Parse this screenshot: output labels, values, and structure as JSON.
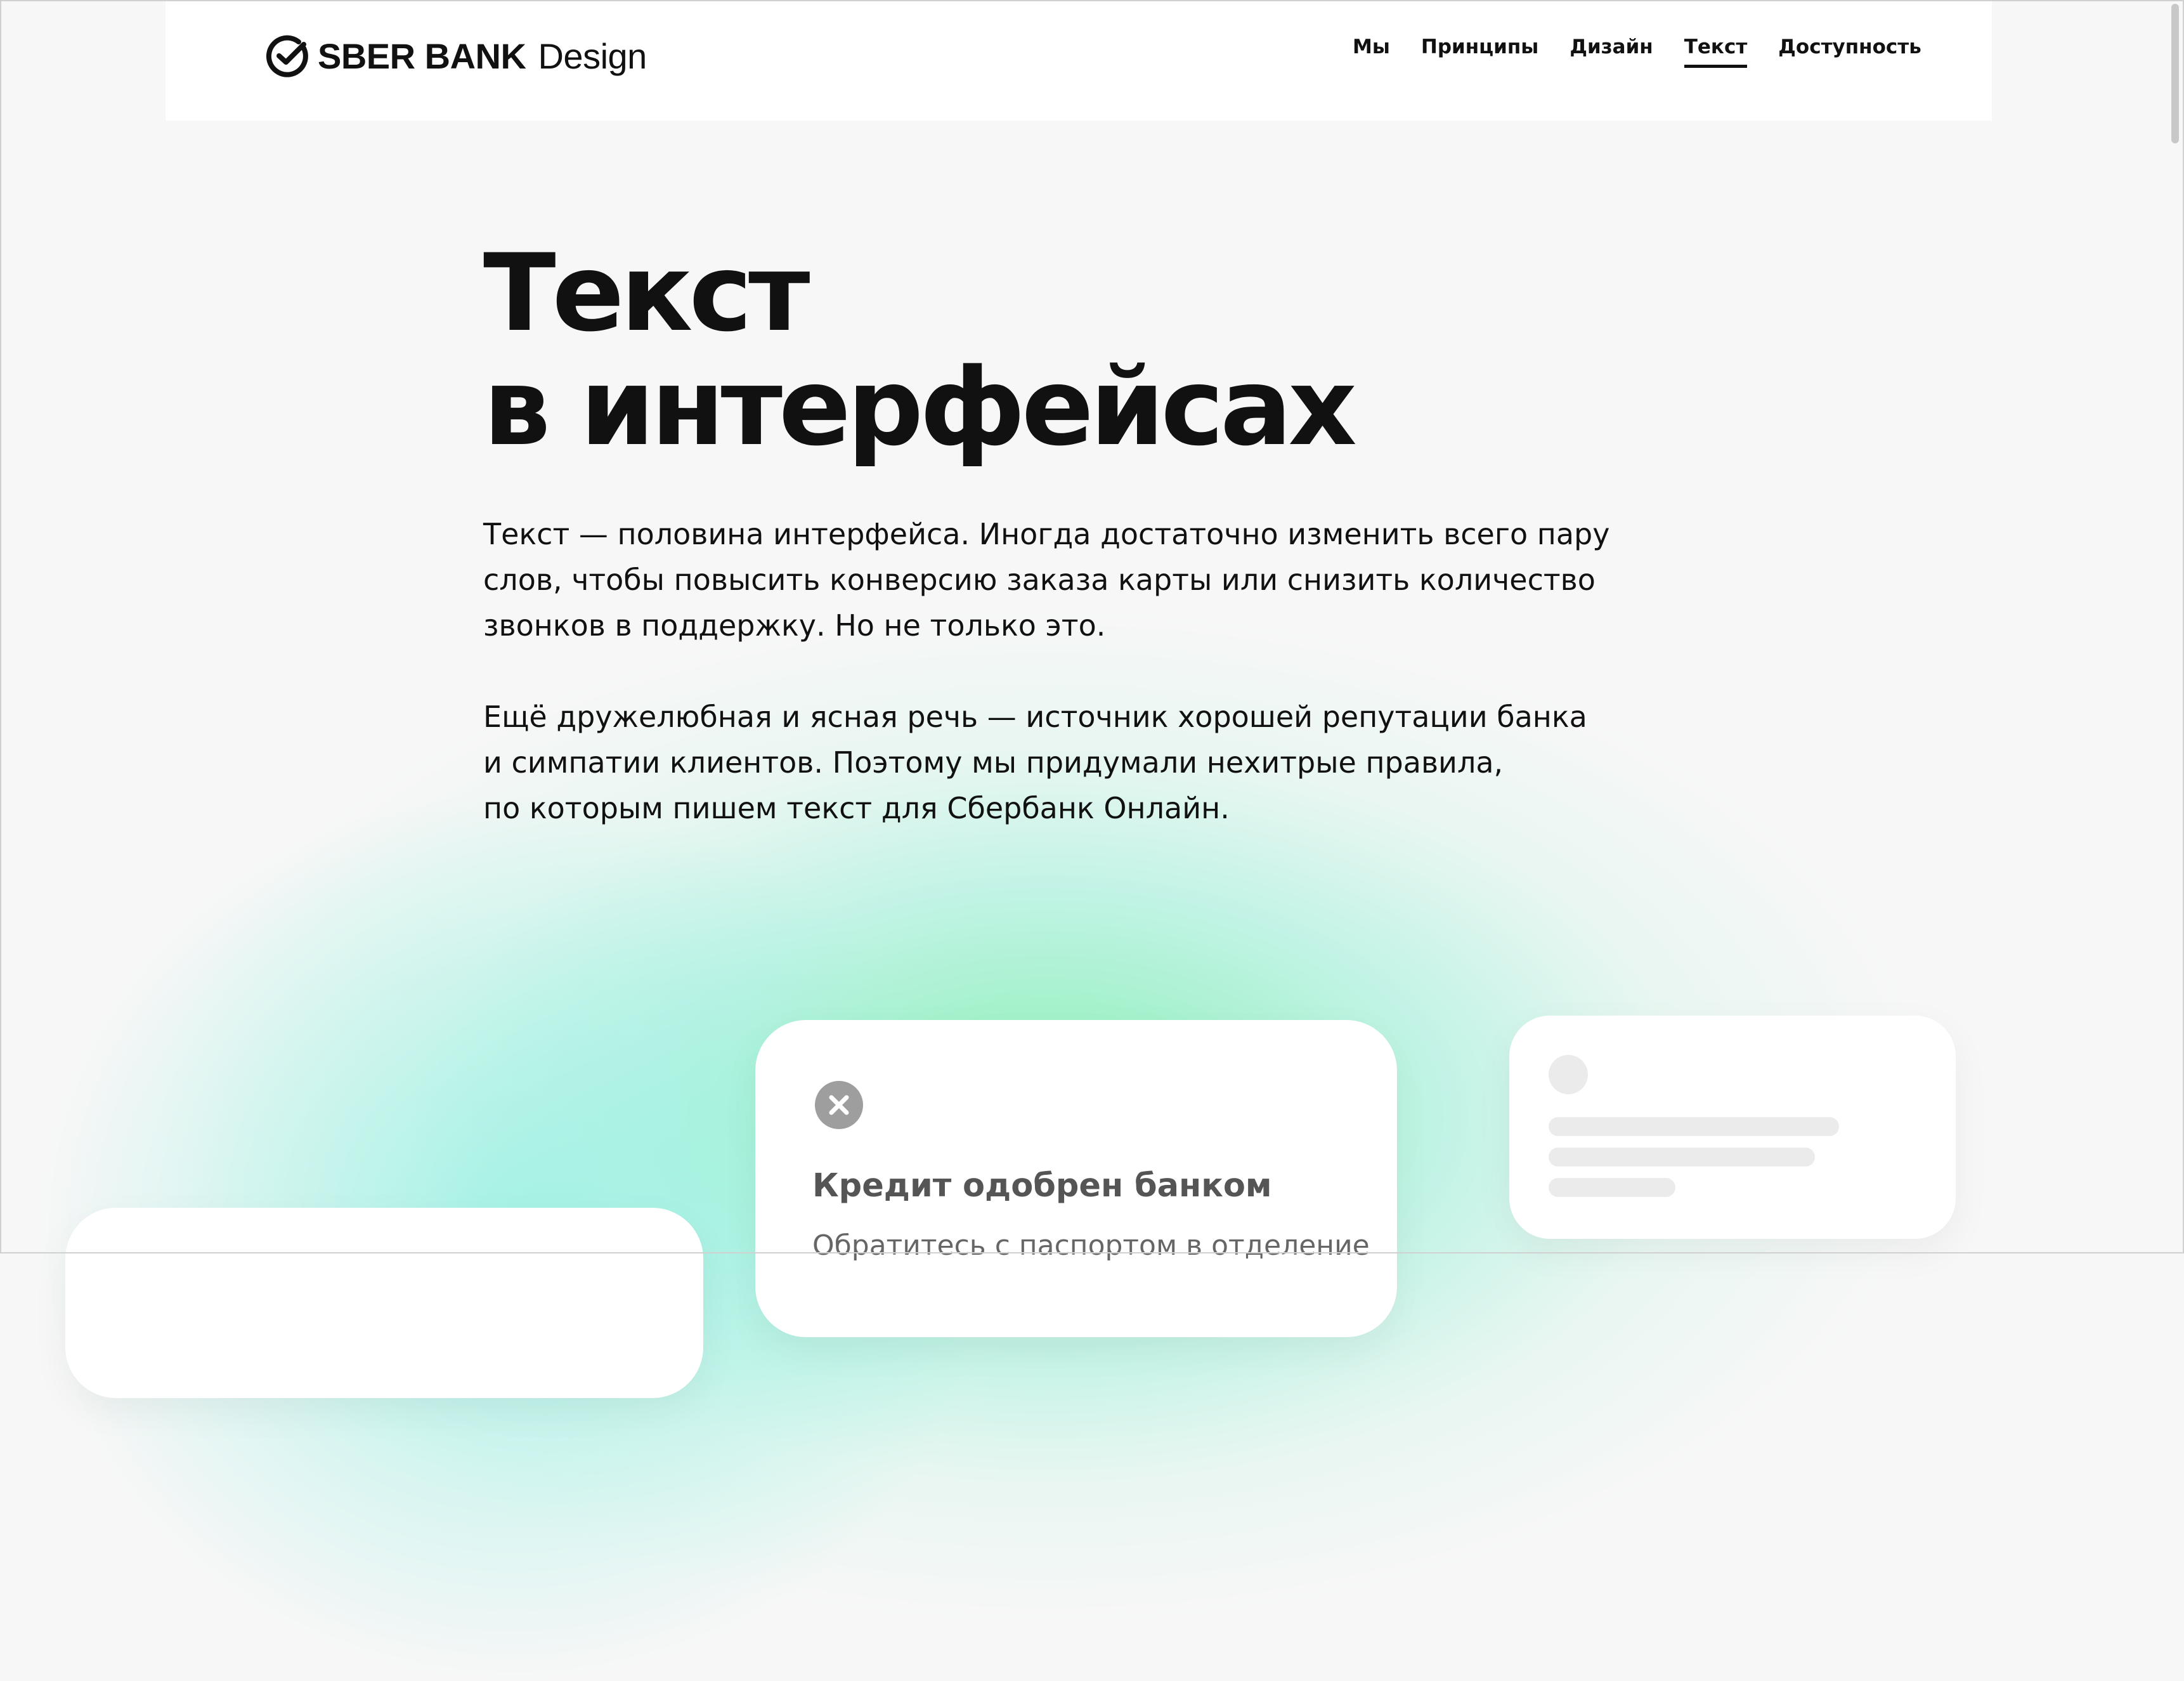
{
  "header": {
    "logo": {
      "brand": "SBER BANK",
      "suffix": "Design",
      "icon": "sber-check-icon"
    },
    "nav": [
      {
        "label": "Мы",
        "active": false
      },
      {
        "label": "Принципы",
        "active": false
      },
      {
        "label": "Дизайн",
        "active": false
      },
      {
        "label": "Текст",
        "active": true
      },
      {
        "label": "Доступность",
        "active": false
      }
    ]
  },
  "hero": {
    "title_lines": [
      "Текст",
      "в интерфейсах"
    ],
    "paragraphs": [
      [
        "Текст — половина интерфейса. Иногда достаточно изменить всего пару",
        "слов, чтобы повысить конверсию заказа карты или снизить количество",
        "звонков в поддержку. Но не только это."
      ],
      [
        "Ещё дружелюбная и ясная речь — источник хорошей репутации банка",
        "и симпатии клиентов. Поэтому мы придумали нехитрые правила,",
        "по которым пишем текст для Сбербанк Онлайн."
      ]
    ]
  },
  "cards": {
    "main": {
      "icon": "close-icon",
      "title": "Кредит одобрен банком",
      "body": "Обратитесь с паспортом в отделение"
    }
  },
  "colors": {
    "text": "#111111",
    "background": "#f7f7f7",
    "accent_green": "#8ef0b0",
    "accent_mint": "#9ff0e0",
    "muted": "#555555",
    "skeleton": "#ebebeb"
  }
}
